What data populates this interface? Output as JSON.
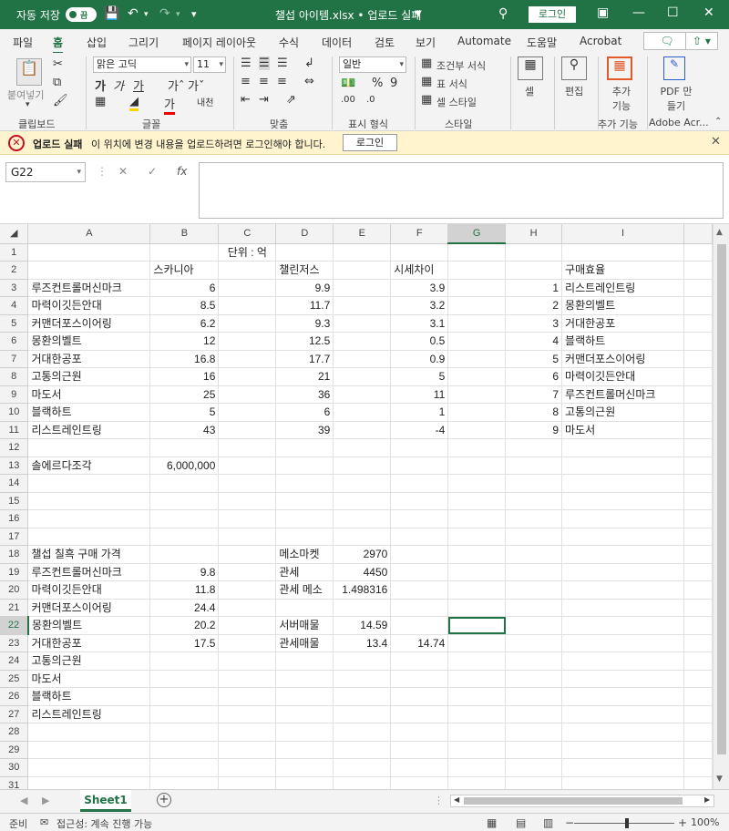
{
  "titlebar": {
    "autosave_label": "자동 저장",
    "autosave_state": "끔",
    "filename": "챌섭 아이템.xlsx • 업로드 실패",
    "login_label": "로그인"
  },
  "ribbon_tabs": [
    "파일",
    "홈",
    "삽입",
    "그리기",
    "페이지 레이아웃",
    "수식",
    "데이터",
    "검토",
    "보기",
    "Automate",
    "도움말",
    "Acrobat"
  ],
  "ribbon": {
    "paste_label": "붙여넣기",
    "font_name": "맑은 고딕",
    "font_size": "11",
    "number_format": "일반",
    "cond_format": "조건부 서식",
    "table_format": "표 서식",
    "cell_style": "셀 스타일",
    "cells_label": "셀",
    "edit_label": "편집",
    "addin_label": "추가 기능",
    "pdf_label": "PDF 만들기",
    "groups": [
      "클립보드",
      "글꼴",
      "맞춤",
      "표시 형식",
      "스타일",
      "추가 기능",
      "Adobe Acr..."
    ]
  },
  "message_bar": {
    "title": "업로드 실패",
    "text": "이 위치에 변경 내용을 업로드하려면 로그인해야 합니다.",
    "button": "로그인"
  },
  "formula_bar": {
    "name_box": "G22",
    "formula": ""
  },
  "grid": {
    "columns": [
      "A",
      "B",
      "C",
      "D",
      "E",
      "F",
      "G",
      "H",
      "I"
    ],
    "rows": [
      [
        "",
        "",
        "단위 : 억",
        "",
        "",
        "",
        "",
        "",
        ""
      ],
      [
        "",
        "스카니아",
        "",
        "챌린저스",
        "",
        "시세차이",
        "",
        "",
        "구매효율"
      ],
      [
        "루즈컨트롤머신마크",
        "6",
        "",
        "9.9",
        "",
        "3.9",
        "",
        "1",
        "리스트레인트링"
      ],
      [
        "마력이깃든안대",
        "8.5",
        "",
        "11.7",
        "",
        "3.2",
        "",
        "2",
        "몽환의벨트"
      ],
      [
        "커맨더포스이어링",
        "6.2",
        "",
        "9.3",
        "",
        "3.1",
        "",
        "3",
        "거대한공포"
      ],
      [
        "몽환의벨트",
        "12",
        "",
        "12.5",
        "",
        "0.5",
        "",
        "4",
        "블랙하트"
      ],
      [
        "거대한공포",
        "16.8",
        "",
        "17.7",
        "",
        "0.9",
        "",
        "5",
        "커맨더포스이어링"
      ],
      [
        "고통의근원",
        "16",
        "",
        "21",
        "",
        "5",
        "",
        "6",
        "마력이깃든안대"
      ],
      [
        "마도서",
        "25",
        "",
        "36",
        "",
        "11",
        "",
        "7",
        "루즈컨트롤머신마크"
      ],
      [
        "블랙하트",
        "5",
        "",
        "6",
        "",
        "1",
        "",
        "8",
        "고통의근원"
      ],
      [
        "리스트레인트링",
        "43",
        "",
        "39",
        "",
        "-4",
        "",
        "9",
        "마도서"
      ],
      [
        "",
        "",
        "",
        "",
        "",
        "",
        "",
        "",
        ""
      ],
      [
        "솔에르다조각",
        "6,000,000",
        "",
        "",
        "",
        "",
        "",
        "",
        ""
      ],
      [
        "",
        "",
        "",
        "",
        "",
        "",
        "",
        "",
        ""
      ],
      [
        "",
        "",
        "",
        "",
        "",
        "",
        "",
        "",
        ""
      ],
      [
        "",
        "",
        "",
        "",
        "",
        "",
        "",
        "",
        ""
      ],
      [
        "",
        "",
        "",
        "",
        "",
        "",
        "",
        "",
        ""
      ],
      [
        "챌섭 칠흑 구매 가격",
        "",
        "",
        "메소마켓",
        "2970",
        "",
        "",
        "",
        ""
      ],
      [
        "루즈컨트롤머신마크",
        "9.8",
        "",
        "관세",
        "4450",
        "",
        "",
        "",
        ""
      ],
      [
        "마력이깃든안대",
        "11.8",
        "",
        "관세 메소",
        "1.498316",
        "",
        "",
        "",
        ""
      ],
      [
        "커맨더포스이어링",
        "24.4",
        "",
        "",
        "",
        "",
        "",
        "",
        ""
      ],
      [
        "몽환의벨트",
        "20.2",
        "",
        "서버매물",
        "14.59",
        "",
        "",
        "",
        ""
      ],
      [
        "거대한공포",
        "17.5",
        "",
        "관세매물",
        "13.4",
        "14.74",
        "",
        "",
        ""
      ],
      [
        "고통의근원",
        "",
        "",
        "",
        "",
        "",
        "",
        "",
        ""
      ],
      [
        "마도서",
        "",
        "",
        "",
        "",
        "",
        "",
        "",
        ""
      ],
      [
        "블랙하트",
        "",
        "",
        "",
        "",
        "",
        "",
        "",
        ""
      ],
      [
        "리스트레인트링",
        "",
        "",
        "",
        "",
        "",
        "",
        "",
        ""
      ],
      [
        "",
        "",
        "",
        "",
        "",
        "",
        "",
        "",
        ""
      ],
      [
        "",
        "",
        "",
        "",
        "",
        "",
        "",
        "",
        ""
      ],
      [
        "",
        "",
        "",
        "",
        "",
        "",
        "",
        "",
        ""
      ],
      [
        "",
        "",
        "",
        "",
        "",
        "",
        "",
        "",
        ""
      ]
    ],
    "selected_cell": "G22"
  },
  "sheet_tabs": [
    "Sheet1"
  ],
  "statusbar": {
    "ready": "준비",
    "accessibility": "접근성: 계속 진행 가능",
    "zoom": "100%"
  },
  "colors": {
    "accent": "#217346",
    "message_bg": "#fff4ce",
    "error": "#c50f1f"
  }
}
